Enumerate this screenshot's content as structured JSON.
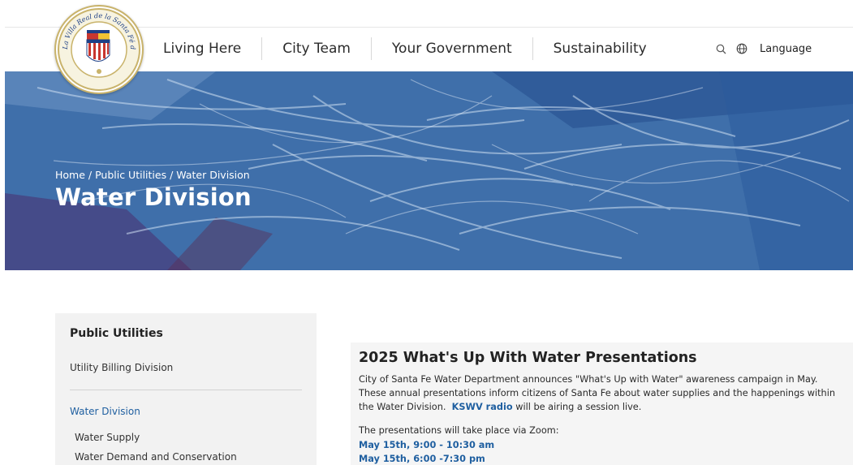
{
  "nav": {
    "items": [
      {
        "label": "Living Here"
      },
      {
        "label": "City Team"
      },
      {
        "label": "Your Government"
      },
      {
        "label": "Sustainability"
      }
    ],
    "language_label": "Language"
  },
  "seal": {
    "text_top": "La Villa Real de la Santa Fé de San Francisco de Asís"
  },
  "hero": {
    "breadcrumb": [
      "Home",
      "Public Utilities",
      "Water Division"
    ],
    "breadcrumb_sep": " / ",
    "title": "Water Division"
  },
  "sidebar": {
    "title": "Public Utilities",
    "items": [
      {
        "label": "Utility Billing Division"
      },
      {
        "label": "Water Division"
      },
      {
        "label": "Water Supply"
      },
      {
        "label": "Water Demand and Conservation"
      }
    ]
  },
  "main": {
    "title": "2025 What's Up With Water Presentations",
    "para_line1": "City of Santa Fe Water Department announces \"What's Up with Water\" awareness campaign in May.",
    "para_line2": "These annual presentations inform citizens of Santa Fe about water supplies and the happenings within",
    "para_line3_pre": "the Water Division.",
    "para_link": "KSWV radio",
    "para_line3_post": " will be airing a session live.",
    "zoom_text": "The presentations will take place via Zoom:",
    "dates": [
      "May 15th, 9:00 - 10:30 am",
      "May 15th, 6:00 -7:30 pm"
    ]
  },
  "colors": {
    "accent": "#1f5fa0",
    "hero": "#3e6fae",
    "sidebar_bg": "#f2f2f2"
  }
}
